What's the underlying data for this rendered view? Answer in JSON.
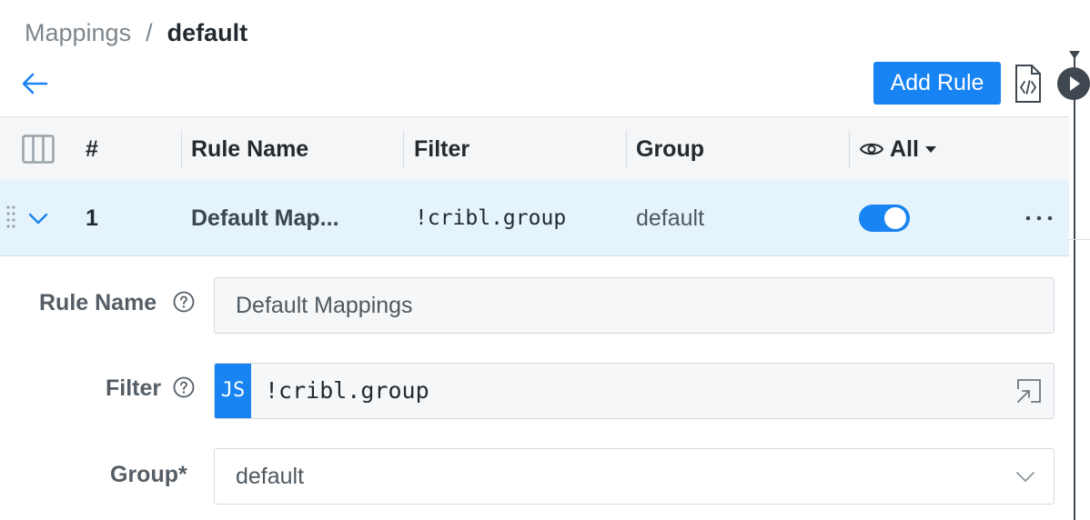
{
  "breadcrumb": {
    "parent": "Mappings",
    "separator": "/",
    "current": "default"
  },
  "toolbar": {
    "add_rule_label": "Add Rule"
  },
  "table": {
    "columns": {
      "number": "#",
      "rule_name": "Rule Name",
      "filter": "Filter",
      "group": "Group",
      "visibility": "All"
    },
    "rows": [
      {
        "number": "1",
        "rule_name": "Default Map...",
        "filter": "!cribl.group",
        "group": "default",
        "enabled": true
      }
    ]
  },
  "form": {
    "rule_name": {
      "label": "Rule Name",
      "value": "Default Mappings"
    },
    "filter": {
      "label": "Filter",
      "badge": "JS",
      "value": "!cribl.group"
    },
    "group": {
      "label": "Group*",
      "value": "default"
    }
  },
  "colors": {
    "accent": "#1883f2",
    "row_highlight": "#e5f3fc",
    "header_bg": "#f5f6f7",
    "timeline": "#3f4850"
  },
  "icons": [
    "back-arrow-icon",
    "code-file-icon",
    "play-icon",
    "columns-icon",
    "eye-icon",
    "caret-down-icon",
    "drag-handle-icon",
    "chevron-down-icon",
    "more-icon",
    "help-icon",
    "expand-icon"
  ]
}
